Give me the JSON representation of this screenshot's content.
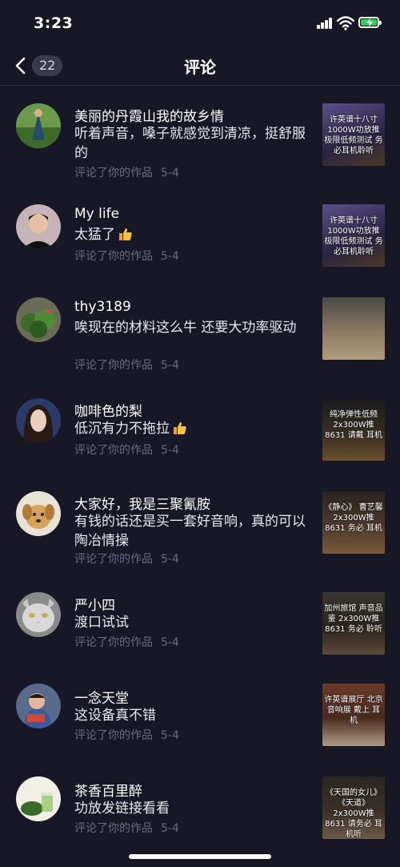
{
  "status": {
    "time": "3:23"
  },
  "nav": {
    "back_count": "22",
    "title": "评论"
  },
  "comments": [
    {
      "name": "美丽的丹霞山我的故乡情",
      "text": "听着声音，嗓子就感觉到清凉，挺舒服的",
      "action": "评论了你的作品",
      "date": "5-4",
      "thumb_caption": "许英谱十八寸 1000W功放推 极限低频测试 务必耳机聆听",
      "avatar_icon": "person-avatar",
      "thumb_icon": "video-thumbnail"
    },
    {
      "name": "My life",
      "text": "太猛了",
      "action": "评论了你的作品",
      "date": "5-4",
      "thumb_caption": "许英谱十八寸 1000W功放推 极限低频测试 务必耳机聆听",
      "avatar_icon": "person-avatar",
      "thumb_icon": "video-thumbnail"
    },
    {
      "name": "thy3189",
      "text": "唉现在的材料这么牛 还要大功率驱动",
      "action": "评论了你的作品",
      "date": "5-4",
      "thumb_caption": "",
      "avatar_icon": "plant-avatar",
      "thumb_icon": "video-thumbnail"
    },
    {
      "name": "咖啡色的梨",
      "text": "低沉有力不拖拉",
      "action": "评论了你的作品",
      "date": "5-4",
      "thumb_caption": "纯净弹性低频 2x300W推8631 请戴 耳机",
      "avatar_icon": "person-avatar",
      "thumb_icon": "video-thumbnail"
    },
    {
      "name": "大家好，我是三聚氰胺",
      "text": "有钱的话还是买一套好音响，真的可以陶冶情操",
      "action": "评论了你的作品",
      "date": "5-4",
      "thumb_caption": "《静心》 曹艺馨 2x300W推8631 务必 耳机",
      "avatar_icon": "dog-avatar",
      "thumb_icon": "video-thumbnail"
    },
    {
      "name": "严小四",
      "text": "渡口试试",
      "action": "评论了你的作品",
      "date": "5-4",
      "thumb_caption": "加州旅馆 声音品鉴 2x300W推8631 务必 聆听",
      "avatar_icon": "cat-avatar",
      "thumb_icon": "video-thumbnail"
    },
    {
      "name": "一念天堂",
      "text": "这设备真不错",
      "action": "评论了你的作品",
      "date": "5-4",
      "thumb_caption": "许英谱展厅 北京音响展 戴上 耳机",
      "avatar_icon": "child-avatar",
      "thumb_icon": "video-thumbnail"
    },
    {
      "name": "茶香百里醉",
      "text": "功放发链接看看",
      "action": "评论了你的作品",
      "date": "5-4",
      "thumb_caption": "《天国的女儿》 《天道》 2x300W推8631 请务必 耳机听",
      "avatar_icon": "tea-avatar",
      "thumb_icon": "video-thumbnail"
    }
  ],
  "colors": {
    "background": "#171726",
    "meta": "#6b6b80",
    "battery": "#2ed158"
  }
}
